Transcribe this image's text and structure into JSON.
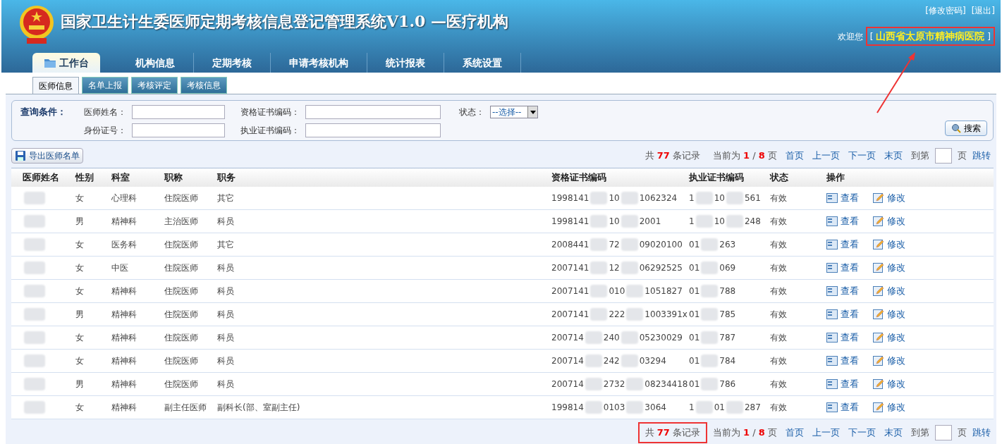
{
  "header": {
    "title": "国家卫生计生委医师定期考核信息登记管理系统V1.0 —医疗机构",
    "links": [
      "[修改密码]",
      "[退出]"
    ],
    "welcome": "欢迎您",
    "org_open": "[",
    "org": "山西省太原市精神病医院",
    "org_close": "]",
    "org_highlighted": true
  },
  "nav": [
    {
      "label": "工作台",
      "selected": true
    },
    {
      "label": "机构信息",
      "selected": false
    },
    {
      "label": "定期考核",
      "selected": false
    },
    {
      "label": "申请考核机构",
      "selected": false
    },
    {
      "label": "统计报表",
      "selected": false
    },
    {
      "label": "系统设置",
      "selected": false
    }
  ],
  "subtabs": [
    {
      "label": "医师信息",
      "selected": true
    },
    {
      "label": "名单上报",
      "selected": false
    },
    {
      "label": "考核评定",
      "selected": false
    },
    {
      "label": "考核信息",
      "selected": false
    }
  ],
  "search": {
    "title": "查询条件：",
    "fields": [
      {
        "label": "医师姓名：",
        "kind": "text"
      },
      {
        "label": "资格证书编码：",
        "kind": "text"
      },
      {
        "label": "状态：",
        "kind": "select",
        "value": "--选择--"
      },
      {
        "label": "身份证号：",
        "kind": "text"
      },
      {
        "label": "执业证书编码：",
        "kind": "text"
      }
    ],
    "button": "搜索"
  },
  "export_button": "导出医师名单",
  "pagers": [
    {
      "total_prefix": "共",
      "total": "77",
      "total_suffix": "条记录",
      "current_prefix": "当前为",
      "page": "1",
      "sep": "/",
      "pages": "8",
      "pages_suffix": "页",
      "links": [
        "首页",
        "上一页",
        "下一页",
        "末页"
      ],
      "goto_prefix": "到第",
      "goto_suffix": "页",
      "goto_button": "跳转",
      "highlighted": false
    },
    {
      "total_prefix": "共",
      "total": "77",
      "total_suffix": "条记录",
      "current_prefix": "当前为",
      "page": "1",
      "sep": "/",
      "pages": "8",
      "pages_suffix": "页",
      "links": [
        "首页",
        "上一页",
        "下一页",
        "末页"
      ],
      "goto_prefix": "到第",
      "goto_suffix": "页",
      "goto_button": "跳转",
      "highlighted": true
    }
  ],
  "table": {
    "columns": [
      "医师姓名",
      "性别",
      "科室",
      "职称",
      "职务",
      "资格证书编码",
      "执业证书编码",
      "状态",
      "操作"
    ],
    "rows": [
      {
        "sex": "女",
        "dept": "心理科",
        "title": "住院医师",
        "duty": "其它",
        "cert": [
          "1998141",
          "10",
          "1062324"
        ],
        "license": [
          "1",
          "10",
          "561"
        ],
        "status": "有效",
        "actions": [
          "查看",
          "修改"
        ]
      },
      {
        "sex": "男",
        "dept": "精神科",
        "title": "主治医师",
        "duty": "科员",
        "cert": [
          "1998141",
          "10",
          "2001"
        ],
        "license": [
          "1",
          "10",
          "248"
        ],
        "status": "有效",
        "actions": [
          "查看",
          "修改"
        ]
      },
      {
        "sex": "女",
        "dept": "医务科",
        "title": "住院医师",
        "duty": "其它",
        "cert": [
          "2008441",
          "72",
          "09020100"
        ],
        "license": [
          "01",
          "263"
        ],
        "status": "有效",
        "actions": [
          "查看",
          "修改"
        ]
      },
      {
        "sex": "女",
        "dept": "中医",
        "title": "住院医师",
        "duty": "科员",
        "cert": [
          "2007141",
          "12",
          "06292525"
        ],
        "license": [
          "01",
          "069"
        ],
        "status": "有效",
        "actions": [
          "查看",
          "修改"
        ]
      },
      {
        "sex": "女",
        "dept": "精神科",
        "title": "住院医师",
        "duty": "科员",
        "cert": [
          "2007141",
          "010",
          "1051827"
        ],
        "license": [
          "01",
          "788"
        ],
        "status": "有效",
        "actions": [
          "查看",
          "修改"
        ]
      },
      {
        "sex": "男",
        "dept": "精神科",
        "title": "住院医师",
        "duty": "科员",
        "cert": [
          "2007141",
          "222",
          "1003391x"
        ],
        "license": [
          "01",
          "785"
        ],
        "status": "有效",
        "actions": [
          "查看",
          "修改"
        ]
      },
      {
        "sex": "女",
        "dept": "精神科",
        "title": "住院医师",
        "duty": "科员",
        "cert": [
          "200714",
          "240",
          "05230029"
        ],
        "license": [
          "01",
          "787"
        ],
        "status": "有效",
        "actions": [
          "查看",
          "修改"
        ]
      },
      {
        "sex": "女",
        "dept": "精神科",
        "title": "住院医师",
        "duty": "科员",
        "cert": [
          "200714",
          "242",
          "03294"
        ],
        "license": [
          "01",
          "784"
        ],
        "status": "有效",
        "actions": [
          "查看",
          "修改"
        ]
      },
      {
        "sex": "男",
        "dept": "精神科",
        "title": "住院医师",
        "duty": "科员",
        "cert": [
          "200714",
          "2732",
          "08234418"
        ],
        "license": [
          "01",
          "786"
        ],
        "status": "有效",
        "actions": [
          "查看",
          "修改"
        ]
      },
      {
        "sex": "女",
        "dept": "精神科",
        "title": "副主任医师",
        "duty": "副科长(部、室副主任)",
        "cert": [
          "199814",
          "0103",
          "3064"
        ],
        "license": [
          "1",
          "01",
          "287"
        ],
        "status": "有效",
        "actions": [
          "查看",
          "修改"
        ]
      }
    ]
  }
}
